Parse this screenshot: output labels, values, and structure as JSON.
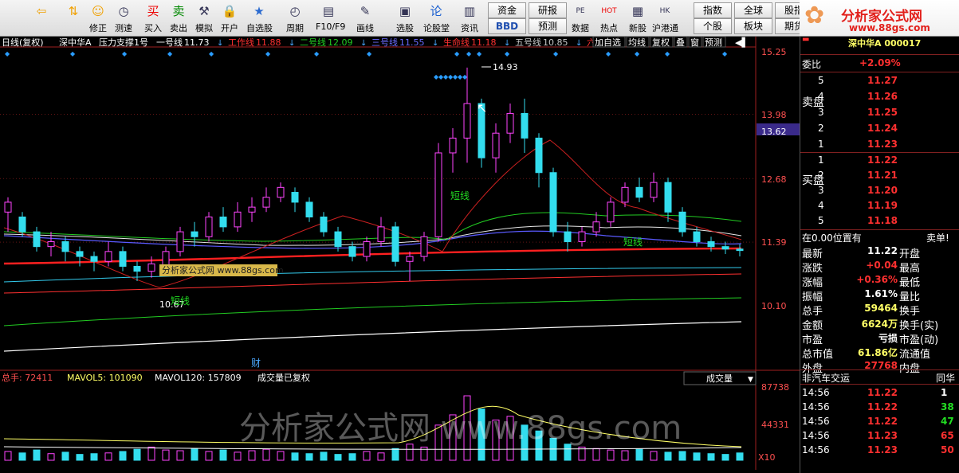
{
  "toolbar": {
    "buttons": [
      {
        "label": "",
        "icon": "back-arrow-icon"
      },
      {
        "label": "",
        "icon": "up-down-arrow-icon"
      },
      {
        "label": "修正",
        "icon": "fix-icon"
      },
      {
        "label": "测速",
        "icon": "speed-icon"
      },
      {
        "label": "买入",
        "icon": "buy-icon"
      },
      {
        "label": "卖出",
        "icon": "sell-icon"
      },
      {
        "label": "模拟",
        "icon": "hammer-icon"
      },
      {
        "label": "开户",
        "icon": "lock-icon"
      },
      {
        "label": "自选股",
        "icon": "star-icon"
      },
      {
        "label": "周期",
        "icon": "clock-icon"
      },
      {
        "label": "F10/F9",
        "icon": "f10-icon"
      },
      {
        "label": "画线",
        "icon": "pen-icon"
      },
      {
        "label": "选股",
        "icon": "screen-icon"
      },
      {
        "label": "论股堂",
        "icon": "forum-icon"
      },
      {
        "label": "资讯",
        "icon": "news-icon"
      },
      {
        "label": "数据",
        "icon": "pe-icon"
      },
      {
        "label": "热点",
        "icon": "hot-icon"
      },
      {
        "label": "新股",
        "icon": "newstock-icon"
      },
      {
        "label": "沪港通",
        "icon": "hk-icon"
      }
    ],
    "small": [
      "资金",
      "研报",
      "BBD",
      "预测",
      "指数",
      "全球",
      "股指",
      "个股",
      "板块",
      "期货"
    ],
    "brand_title": "分析家公式网",
    "brand_url": "www.88gs.com"
  },
  "chart_header": {
    "period": "日线(复权)",
    "stock": "深中华A",
    "indicator": "压力支撑1号",
    "lines": [
      {
        "name": "一号线",
        "value": "11.73",
        "color": "#ffffff"
      },
      {
        "name": "工作线",
        "value": "11.88",
        "color": "#ff3030"
      },
      {
        "name": "二号线",
        "value": "12.09",
        "color": "#22cc22"
      },
      {
        "name": "三号线",
        "value": "11.55",
        "color": "#6b6bff"
      },
      {
        "name": "生命线",
        "value": "11.18",
        "color": "#ff3030"
      },
      {
        "name": "五号线",
        "value": "10.85",
        "color": "#c8c8c8"
      },
      {
        "name": "六号",
        "value": "",
        "color": "#ff3030"
      }
    ],
    "right_buttons": [
      "加自选",
      "均线",
      "复权",
      "叠",
      "窗",
      "预测"
    ]
  },
  "price_axis": [
    "15.25",
    "13.98",
    "13.62",
    "12.68",
    "11.39",
    "10.10"
  ],
  "annotations": {
    "high": "14.93",
    "low": "10.67",
    "short_line": "短线",
    "watermark_small": "分析家公式网 www.88gs.com",
    "cai": "财"
  },
  "volume_header": {
    "total": "总手: 72411",
    "mavol5": "MAVOL5: 101090",
    "mavol120": "MAVOL120: 157809",
    "note": "成交量已复权",
    "dropdown": "成交量"
  },
  "volume_axis": [
    "87738",
    "44331",
    "X10"
  ],
  "watermark": "分析家公式网 www.88gs.com",
  "colors": {
    "up": "#ff44ff",
    "down": "#33ddee",
    "accent": "#ff3030"
  },
  "panel": {
    "title_partial": "深中华A 000017",
    "weibi_label": "委比",
    "weibi_value": "+2.09%",
    "sell_label": "卖盘",
    "buy_label": "买盘",
    "sell": [
      {
        "lvl": "5",
        "price": "11.27"
      },
      {
        "lvl": "4",
        "price": "11.26"
      },
      {
        "lvl": "3",
        "price": "11.25"
      },
      {
        "lvl": "2",
        "price": "11.24"
      },
      {
        "lvl": "1",
        "price": "11.23"
      }
    ],
    "buy": [
      {
        "lvl": "1",
        "price": "11.22"
      },
      {
        "lvl": "2",
        "price": "11.21"
      },
      {
        "lvl": "3",
        "price": "11.20"
      },
      {
        "lvl": "4",
        "price": "11.19"
      },
      {
        "lvl": "5",
        "price": "11.18"
      }
    ],
    "position_note": "在0.00位置有",
    "sell_one": "卖单!",
    "stats": [
      {
        "l": "最新",
        "v": "11.22",
        "r": "开盘",
        "c": "#ffffff"
      },
      {
        "l": "涨跌",
        "v": "+0.04",
        "r": "最高",
        "c": "#ff3030"
      },
      {
        "l": "涨幅",
        "v": "+0.36%",
        "r": "最低",
        "c": "#ff3030"
      },
      {
        "l": "振幅",
        "v": "1.61%",
        "r": "量比",
        "c": "#ffffff"
      },
      {
        "l": "总手",
        "v": "59464",
        "r": "换手",
        "c": "#ffff66"
      },
      {
        "l": "金额",
        "v": "6624万",
        "r": "换手(实)",
        "c": "#ffff66"
      },
      {
        "l": "市盈",
        "v": "亏损",
        "r": "市盈(动)",
        "c": "#ffffff"
      },
      {
        "l": "总市值",
        "v": "61.86亿",
        "r": "流通值",
        "c": "#ffff66"
      },
      {
        "l": "外盘",
        "v": "27768",
        "r": "内盘",
        "c": "#ff3030"
      }
    ],
    "sector": "非汽车交运",
    "sector_right": "同华",
    "ticks": [
      {
        "t": "14:56",
        "p": "11.22",
        "v": "1",
        "c": "#ffffff"
      },
      {
        "t": "14:56",
        "p": "11.22",
        "v": "38",
        "c": "#22dd22"
      },
      {
        "t": "14:56",
        "p": "11.22",
        "v": "47",
        "c": "#22dd22"
      },
      {
        "t": "14:56",
        "p": "11.23",
        "v": "65",
        "c": "#ff3030"
      },
      {
        "t": "14:56",
        "p": "11.23",
        "v": "50",
        "c": "#ff3030"
      }
    ]
  }
}
